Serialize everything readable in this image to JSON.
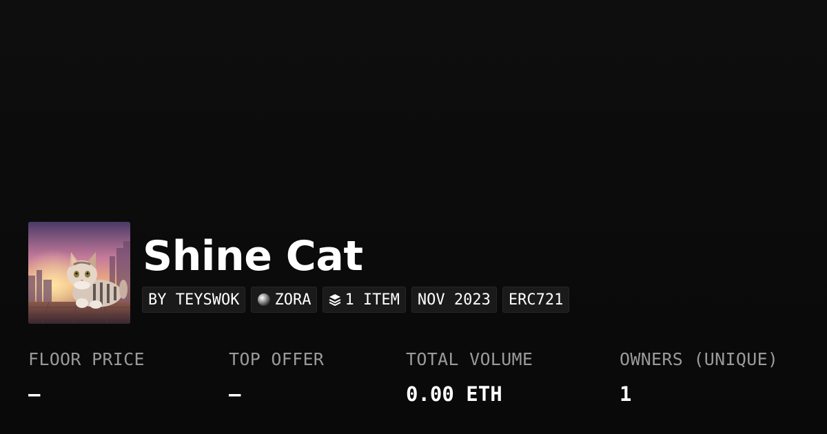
{
  "collection": {
    "name": "Shine Cat",
    "image_icon": "cat-artwork-image"
  },
  "tags": [
    {
      "label": "BY TEYSWOK",
      "icon": ""
    },
    {
      "label": "ZORA",
      "icon": "zora-orb-icon"
    },
    {
      "label": "1 ITEM",
      "icon": "layers-icon"
    },
    {
      "label": "NOV 2023",
      "icon": ""
    },
    {
      "label": "ERC721",
      "icon": ""
    }
  ],
  "stats": [
    {
      "label": "FLOOR PRICE",
      "value": "–"
    },
    {
      "label": "TOP OFFER",
      "value": "–"
    },
    {
      "label": "TOTAL VOLUME",
      "value": "0.00 ETH"
    },
    {
      "label": "OWNERS (UNIQUE)",
      "value": "1"
    }
  ],
  "colors": {
    "background": "#0b0b0b",
    "text": "#ffffff",
    "muted": "#9a9a9a",
    "pill_bg": "#1a1a1a"
  }
}
